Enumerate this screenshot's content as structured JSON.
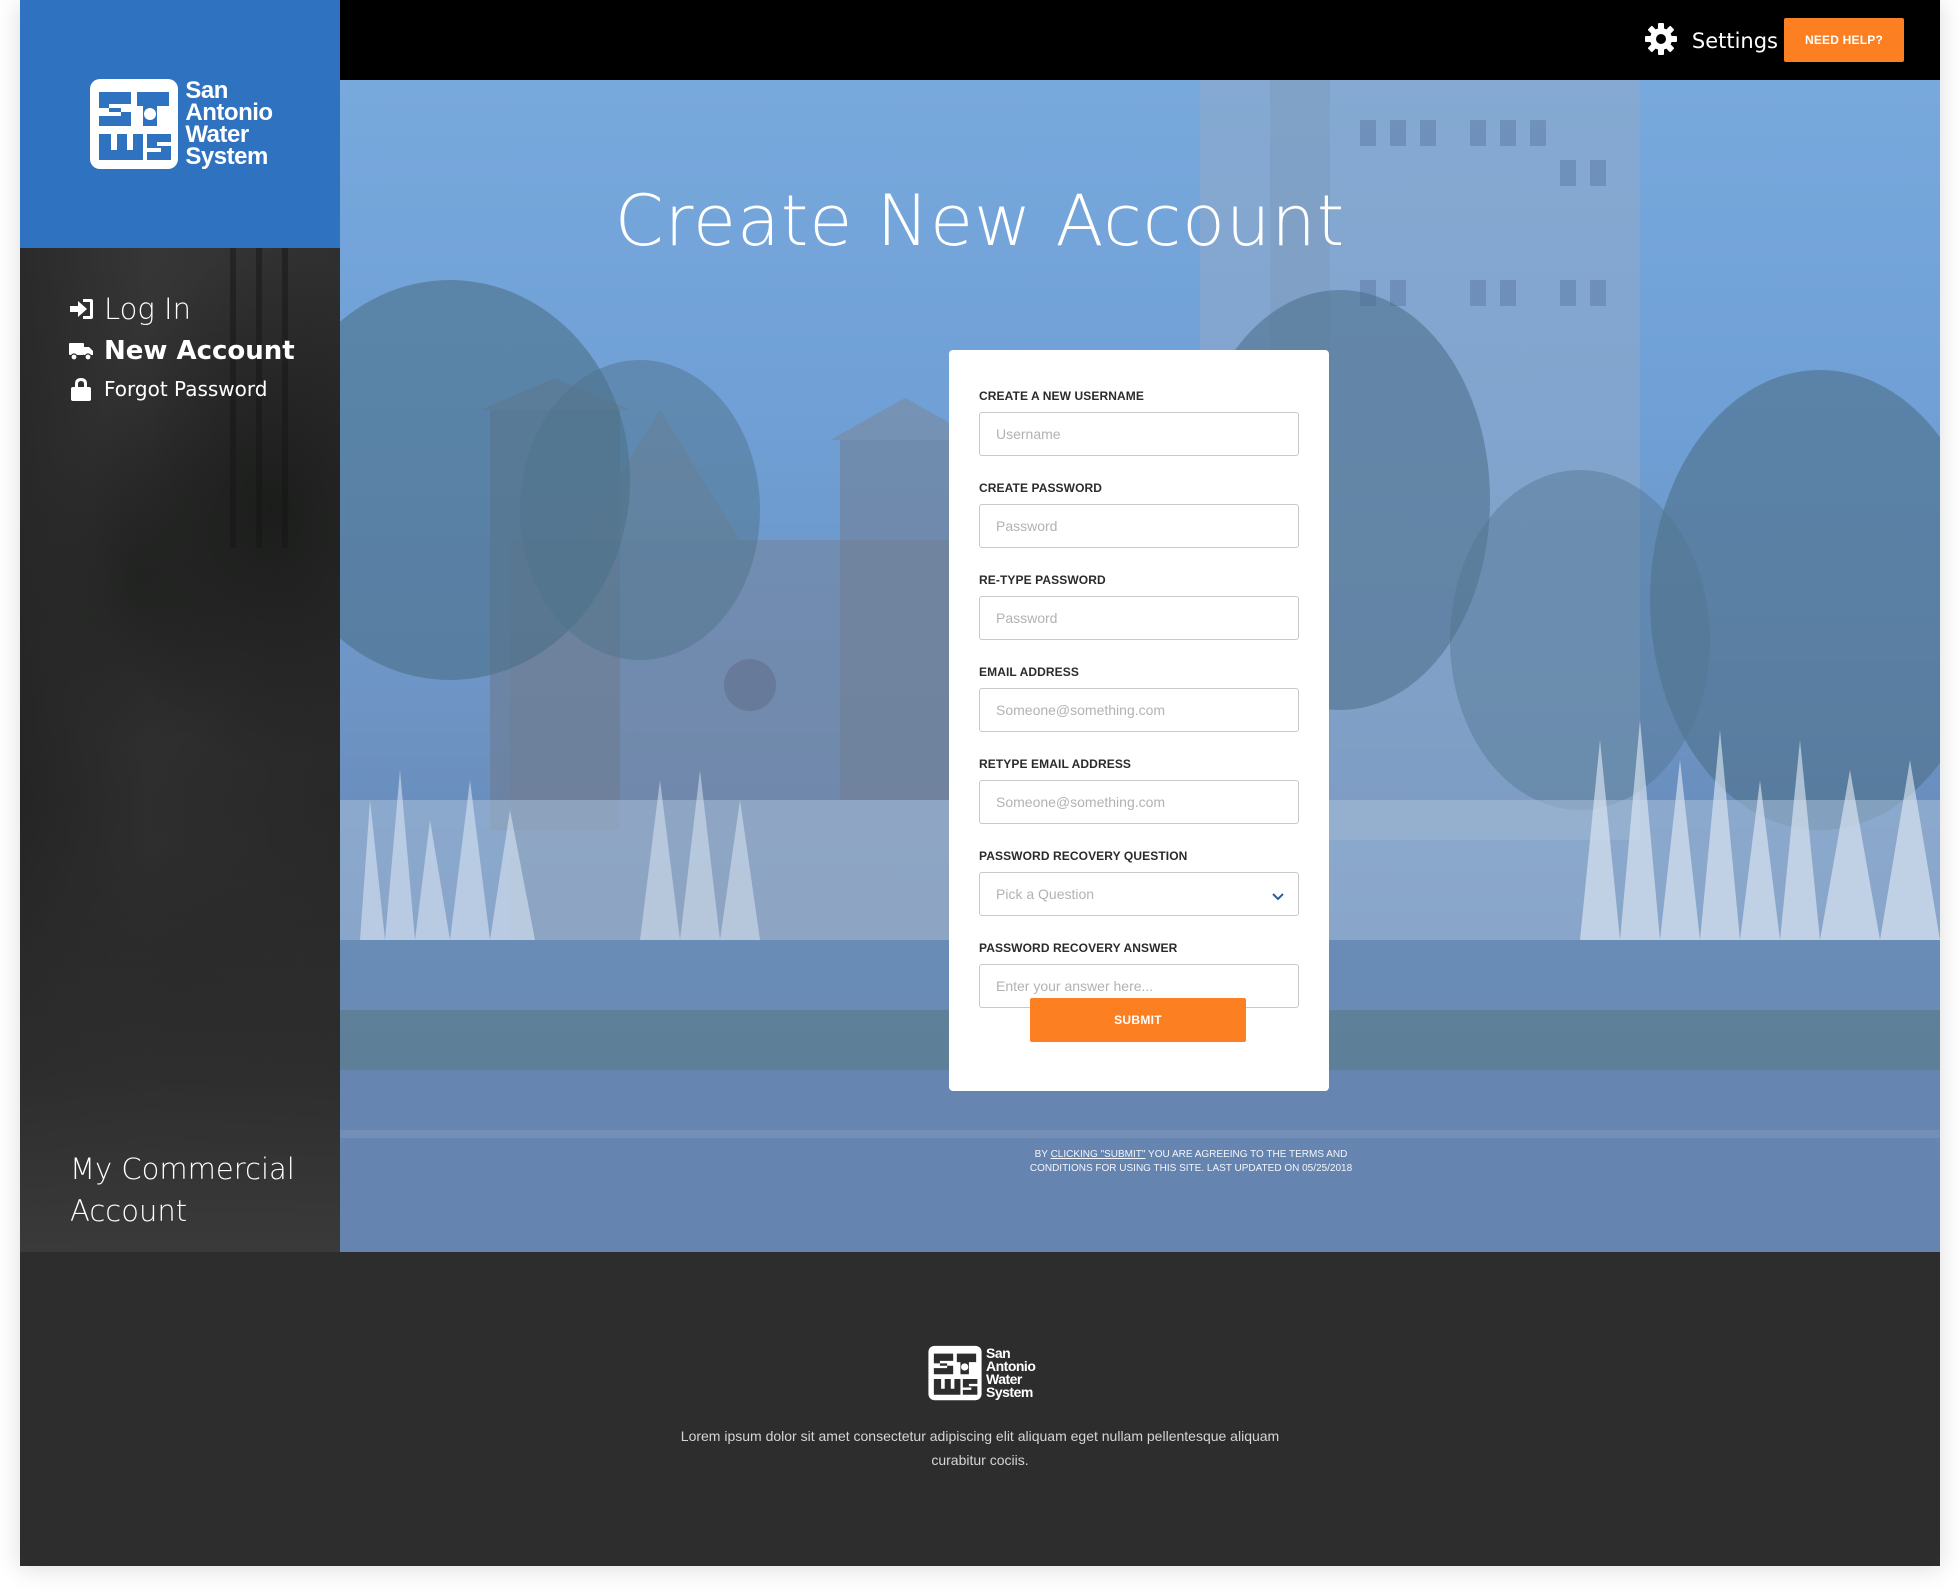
{
  "brand": {
    "logo_lines": [
      "San",
      "Antonio",
      "Water",
      "System"
    ]
  },
  "topbar": {
    "settings_icon": "gear-icon",
    "settings_label": "Settings",
    "help_label": "NEED HELP?"
  },
  "sidebar": {
    "nav": [
      {
        "label": "Log In",
        "icon": "login-arrow-icon"
      },
      {
        "label": "New Account",
        "icon": "truck-icon"
      },
      {
        "label": "Forgot Password",
        "icon": "lock-icon"
      }
    ],
    "commercial_lines": [
      "My Commercial",
      "Account"
    ]
  },
  "main": {
    "title": "Create New Account"
  },
  "form": {
    "username": {
      "label": "CREATE A NEW USERNAME",
      "placeholder": "Username"
    },
    "password": {
      "label": "CREATE PASSWORD",
      "placeholder": "Password"
    },
    "password_confirm": {
      "label": "RE-TYPE PASSWORD",
      "placeholder": "Password"
    },
    "email": {
      "label": "EMAIL ADDRESS",
      "placeholder": "Someone@something.com"
    },
    "email_confirm": {
      "label": "RETYPE EMAIL ADDRESS",
      "placeholder": "Someone@something.com"
    },
    "question": {
      "label": "PASSWORD RECOVERY QUESTION",
      "selected": "Pick a Question",
      "icon": "chevron-down-icon"
    },
    "answer": {
      "label": "PASSWORD RECOVERY ANSWER",
      "placeholder": "Enter your answer here..."
    },
    "submit_label": "SUBMIT"
  },
  "terms": {
    "prefix": "BY ",
    "link": "CLICKING \"SUBMIT\"",
    "rest": " YOU ARE AGREEING TO THE TERMS AND CONDITIONS FOR USING THIS SITE. LAST UPDATED ON 05/25/2018"
  },
  "footer": {
    "text": "Lorem ipsum dolor sit amet consectetur adipiscing elit aliquam eget nullam pellentesque aliquam curabitur cociis."
  },
  "colors": {
    "brand_blue": "#2f72c0",
    "accent_orange": "#fc7f22",
    "sidebar_dark": "#3a3a3a",
    "footer_dark": "#2d2d2d",
    "hero_overlay": "#6f9fd5"
  }
}
